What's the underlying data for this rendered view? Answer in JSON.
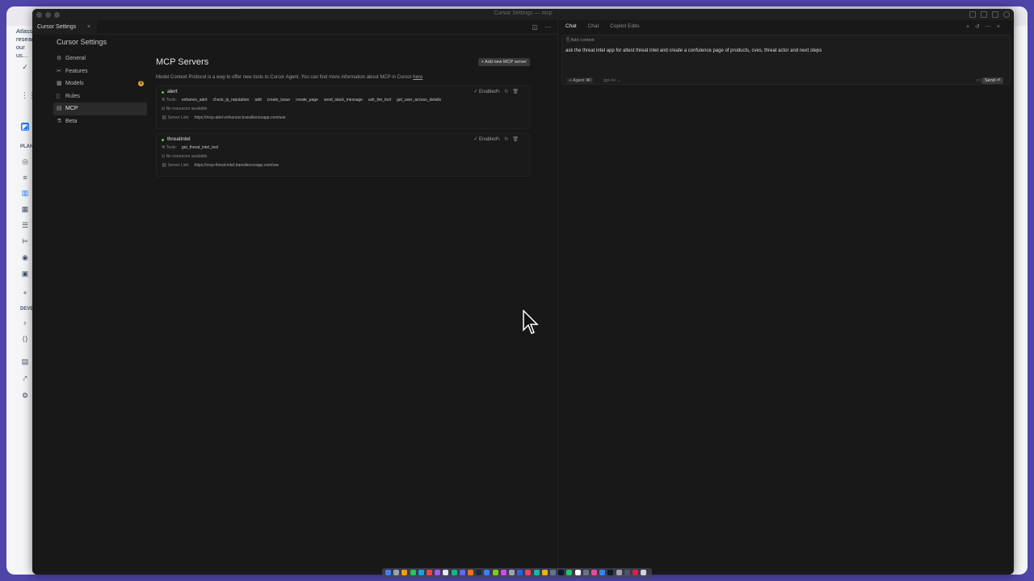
{
  "background": {
    "banner_text": "Atlassian research... our us...",
    "sidebar_sections": [
      "PLAN",
      "DEVE"
    ]
  },
  "window": {
    "title": "Cursor Settings — mcp"
  },
  "tab": {
    "label": "Cursor Settings",
    "close": "×"
  },
  "settings": {
    "title": "Cursor Settings",
    "nav": [
      {
        "label": "General",
        "icon": "gear-icon",
        "glyph": "⚙"
      },
      {
        "label": "Features",
        "icon": "tools-icon",
        "glyph": "✂"
      },
      {
        "label": "Models",
        "icon": "models-icon",
        "glyph": "▦",
        "badge": "3"
      },
      {
        "label": "Rules",
        "icon": "rules-icon",
        "glyph": "▯"
      },
      {
        "label": "MCP",
        "icon": "mcp-icon",
        "glyph": "▤",
        "active": true
      },
      {
        "label": "Beta",
        "icon": "beta-icon",
        "glyph": "⚗"
      }
    ]
  },
  "mcp": {
    "title": "MCP Servers",
    "add_button": "+ Add new MCP server",
    "description": "Model Context Protocol is a way to offer new tools to Cursor Agent. You can find more information about MCP in Cursor ",
    "description_link": "here",
    "servers": [
      {
        "name": "alert",
        "status": "✓ Enabled",
        "tools_label": "Tools:",
        "tools": [
          "enhance_alert",
          "check_ip_reputation",
          "add",
          "create_issue",
          "create_page",
          "send_slack_message",
          "ask_tim_tool",
          "get_user_access_details"
        ],
        "resources": "No resources available",
        "link_label": "Server Link:",
        "link": "https://mcp-alert-enhancer.transilienceapp.com/sse"
      },
      {
        "name": "threatintel",
        "status": "✓ Enabled",
        "tools_label": "Tools:",
        "tools": [
          "get_threat_intel_tool"
        ],
        "resources": "No resources available",
        "link_label": "Server Link:",
        "link": "https://mcp-threat-intel.transilienceapp.com/sse"
      }
    ]
  },
  "chat": {
    "tabs": [
      "Chat",
      "Chat",
      "Copilot Edits"
    ],
    "add_context": "Add context",
    "input_text": "ask the threat intel app for altest threat intel and create a confulence page of products, cves, threat actor and next steps",
    "agent_label": "∞ Agent ⌘I",
    "model_label": "gpt-4o ⌄",
    "send_label": "Send ⏎"
  },
  "colors": {
    "accent_badge": "#d9a13a",
    "enabled_dot": "#4ec96b",
    "desktop": "#4f44a8"
  }
}
